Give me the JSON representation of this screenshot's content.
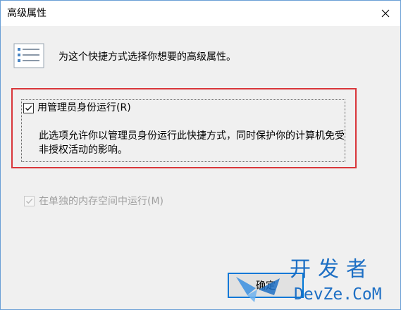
{
  "window": {
    "title": "高级属性",
    "close_icon": "close-icon",
    "border_color": "#6a9fd6"
  },
  "intro": {
    "icon": "properties-list-icon",
    "text": "为这个快捷方式选择你想要的高级属性。"
  },
  "run_as_admin": {
    "checked": true,
    "label": "用管理员身份运行(R)",
    "description": "此选项允许你以管理员身份运行此快捷方式，同时保护你的计算机免受非授权活动的影响。"
  },
  "separate_memory": {
    "checked": true,
    "disabled": true,
    "label": "在单独的内存空间中运行(M)"
  },
  "buttons": {
    "ok_label": "确定"
  },
  "watermark": {
    "text_cn": "开发者",
    "text_en": "DevZe.CoM",
    "icon": "butterfly-logo-icon"
  },
  "colors": {
    "highlight": "#d9363a",
    "accent": "#0078d7",
    "watermark": "#1d6fc4"
  }
}
